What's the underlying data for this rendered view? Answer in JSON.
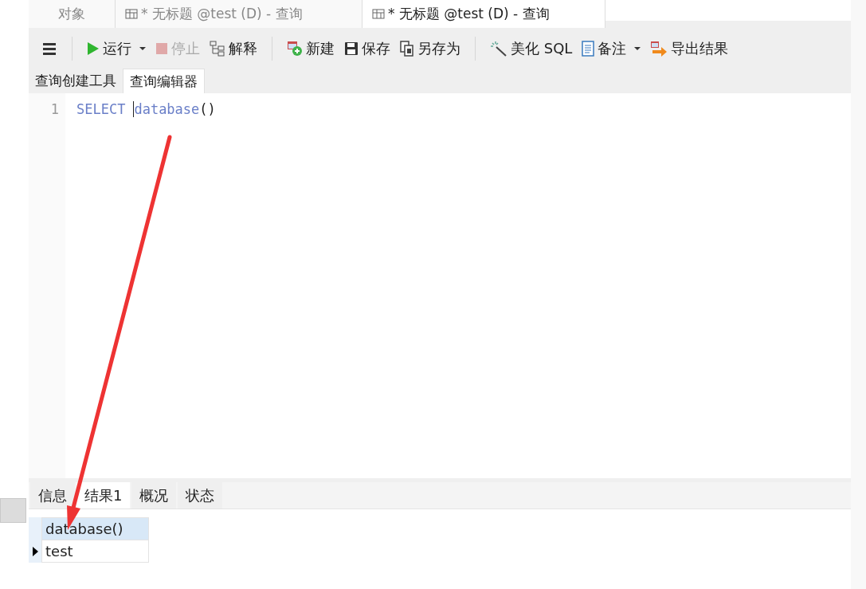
{
  "doc_tabs": [
    {
      "label": "对象",
      "kind": "objects",
      "selected": false
    },
    {
      "label": "* 无标题 @test (D) - 查询",
      "kind": "query",
      "selected": false
    },
    {
      "label": "* 无标题 @test (D) - 查询",
      "kind": "query",
      "selected": true
    }
  ],
  "toolbar": [
    {
      "kind": "menu"
    },
    {
      "kind": "separator"
    },
    {
      "kind": "run",
      "label": "运行",
      "dropdown": true,
      "disabled": false
    },
    {
      "kind": "stop",
      "label": "停止",
      "dropdown": false,
      "disabled": true
    },
    {
      "kind": "explain",
      "label": "解释",
      "dropdown": false,
      "disabled": false
    },
    {
      "kind": "separator"
    },
    {
      "kind": "new",
      "label": "新建",
      "dropdown": false,
      "disabled": false
    },
    {
      "kind": "save",
      "label": "保存",
      "dropdown": false,
      "disabled": false
    },
    {
      "kind": "save-as",
      "label": "另存为",
      "dropdown": false,
      "disabled": false
    },
    {
      "kind": "separator"
    },
    {
      "kind": "beautify",
      "label": "美化 SQL",
      "dropdown": false,
      "disabled": false
    },
    {
      "kind": "comment",
      "label": "备注",
      "dropdown": true,
      "disabled": false
    },
    {
      "kind": "export",
      "label": "导出结果",
      "dropdown": false,
      "disabled": false
    }
  ],
  "mode_tabs": [
    {
      "label": "查询创建工具",
      "selected": false
    },
    {
      "label": "查询编辑器",
      "selected": true
    }
  ],
  "editor": {
    "lines": [
      {
        "number": "1",
        "tokens": [
          {
            "text": "SELECT",
            "kind": "keyword"
          },
          {
            "text": "database",
            "kind": "function"
          },
          {
            "text": "()",
            "kind": "plain"
          }
        ]
      }
    ]
  },
  "result_tabs": [
    {
      "label": "信息",
      "selected": false
    },
    {
      "label": "结果1",
      "selected": true
    },
    {
      "label": "概况",
      "selected": false
    },
    {
      "label": "状态",
      "selected": false
    }
  ],
  "grid": {
    "columns": [
      "database()"
    ],
    "rows": [
      {
        "cells": [
          "test"
        ],
        "current": true
      }
    ]
  }
}
